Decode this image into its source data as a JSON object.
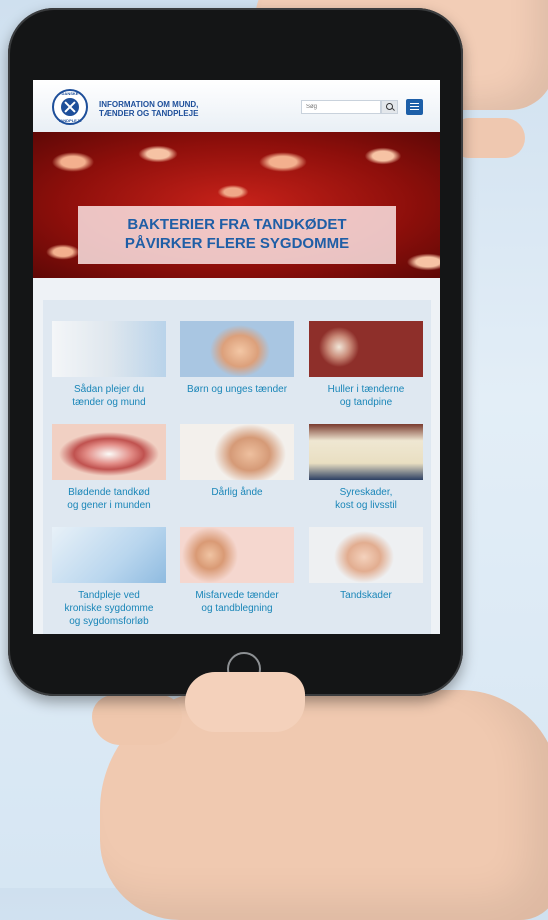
{
  "header": {
    "logo_top": "DANSKE",
    "logo_bottom": "TANDPLEJE",
    "brand_line1": "INFORMATION OM MUND,",
    "brand_line2": "TÆNDER OG TANDPLEJE",
    "search_placeholder": "Søg"
  },
  "hero": {
    "title_line1": "BAKTERIER FRA TANDKØDET",
    "title_line2": "PÅVIRKER FLERE SYGDOMME"
  },
  "cards": [
    {
      "line1": "Sådan plejer du",
      "line2": "tænder og mund",
      "line3": ""
    },
    {
      "line1": "Børn og unges tænder",
      "line2": "",
      "line3": ""
    },
    {
      "line1": "Huller i tænderne",
      "line2": "og tandpine",
      "line3": ""
    },
    {
      "line1": "Blødende tandkød",
      "line2": "og gener i munden",
      "line3": ""
    },
    {
      "line1": "Dårlig ånde",
      "line2": "",
      "line3": ""
    },
    {
      "line1": "Syreskader,",
      "line2": "kost og livsstil",
      "line3": ""
    },
    {
      "line1": "Tandpleje ved",
      "line2": "kroniske sygdomme",
      "line3": "og sygdomsforløb"
    },
    {
      "line1": "Misfarvede tænder",
      "line2": "og tandblegning",
      "line3": ""
    },
    {
      "line1": "Tandskader",
      "line2": "",
      "line3": ""
    }
  ]
}
